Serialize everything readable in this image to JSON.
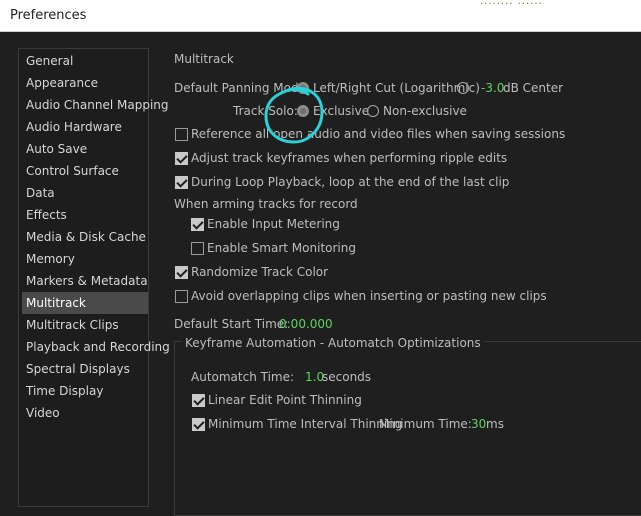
{
  "window": {
    "title": "Preferences"
  },
  "sidebar": {
    "items": [
      {
        "label": "General"
      },
      {
        "label": "Appearance"
      },
      {
        "label": "Audio Channel Mapping"
      },
      {
        "label": "Audio Hardware"
      },
      {
        "label": "Auto Save"
      },
      {
        "label": "Control Surface"
      },
      {
        "label": "Data"
      },
      {
        "label": "Effects"
      },
      {
        "label": "Media & Disk Cache"
      },
      {
        "label": "Memory"
      },
      {
        "label": "Markers & Metadata"
      },
      {
        "label": "Multitrack"
      },
      {
        "label": "Multitrack Clips"
      },
      {
        "label": "Playback and Recording"
      },
      {
        "label": "Spectral Displays"
      },
      {
        "label": "Time Display"
      },
      {
        "label": "Video"
      }
    ],
    "selected": "Multitrack"
  },
  "multitrack": {
    "section_title": "Multitrack",
    "panning": {
      "label": "Default Panning Mode:",
      "option_a": "Left/Right Cut (Logarithmic)",
      "option_b_value": "-3.0",
      "option_b_suffix": "dB Center",
      "selected": "option_a"
    },
    "track_solo": {
      "label": "Track Solo:",
      "option_a": "Exclusive",
      "option_b": "Non-exclusive",
      "selected": "option_a"
    },
    "checkboxes": {
      "reference_files": {
        "label": "Reference all open audio and video files when saving sessions",
        "checked": false
      },
      "adjust_keyframes": {
        "label": "Adjust track keyframes when performing ripple edits",
        "checked": true
      },
      "loop_playback": {
        "label": "During Loop Playback, loop at the end of the last clip",
        "checked": true
      },
      "enable_input_metering": {
        "label": "Enable Input Metering",
        "checked": true
      },
      "enable_smart_monitoring": {
        "label": "Enable Smart Monitoring",
        "checked": false
      },
      "randomize_color": {
        "label": "Randomize Track Color",
        "checked": true
      },
      "avoid_overlap": {
        "label": "Avoid overlapping clips when inserting or pasting new clips",
        "checked": false
      }
    },
    "arming_label": "When arming tracks for record",
    "default_start": {
      "label": "Default Start Time:",
      "value": "0:00.000"
    }
  },
  "keyframe_automation": {
    "title": "Keyframe Automation - Automatch Optimizations",
    "automatch": {
      "label": "Automatch Time:",
      "value": "1.0",
      "unit": "seconds"
    },
    "linear_thinning": {
      "label": "Linear Edit Point Thinning",
      "checked": true
    },
    "min_interval": {
      "label": "Minimum Time Interval Thinning",
      "checked": true
    },
    "min_time": {
      "label": "Minimum Time:",
      "value": "30",
      "unit": "ms"
    }
  },
  "colors": {
    "value_green": "#5fd35f",
    "annotation_cyan": "#2ad1d8",
    "selection": "#4a4a4a"
  }
}
